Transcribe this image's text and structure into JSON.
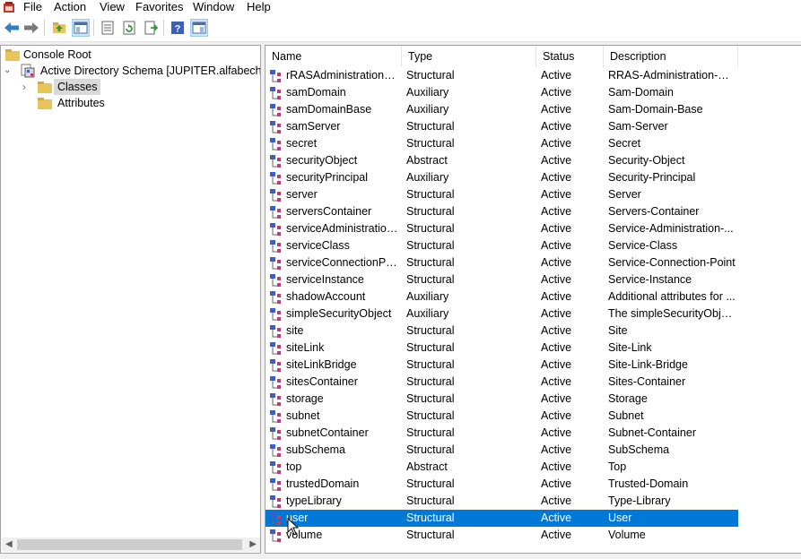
{
  "menu": [
    "File",
    "Action",
    "View",
    "Favorites",
    "Window",
    "Help"
  ],
  "tree": {
    "root": "Console Root",
    "schema": "Active Directory Schema [JUPITER.alfabech.lab]",
    "classes": "Classes",
    "attributes": "Attributes"
  },
  "columns": {
    "name": "Name",
    "type": "Type",
    "status": "Status",
    "description": "Description"
  },
  "rows": [
    {
      "name": "rRASAdministrationDi...",
      "type": "Structural",
      "status": "Active",
      "description": "RRAS-Administration-Di..."
    },
    {
      "name": "samDomain",
      "type": "Auxiliary",
      "status": "Active",
      "description": "Sam-Domain"
    },
    {
      "name": "samDomainBase",
      "type": "Auxiliary",
      "status": "Active",
      "description": "Sam-Domain-Base"
    },
    {
      "name": "samServer",
      "type": "Structural",
      "status": "Active",
      "description": "Sam-Server"
    },
    {
      "name": "secret",
      "type": "Structural",
      "status": "Active",
      "description": "Secret"
    },
    {
      "name": "securityObject",
      "type": "Abstract",
      "status": "Active",
      "description": "Security-Object"
    },
    {
      "name": "securityPrincipal",
      "type": "Auxiliary",
      "status": "Active",
      "description": "Security-Principal"
    },
    {
      "name": "server",
      "type": "Structural",
      "status": "Active",
      "description": "Server"
    },
    {
      "name": "serversContainer",
      "type": "Structural",
      "status": "Active",
      "description": "Servers-Container"
    },
    {
      "name": "serviceAdministration...",
      "type": "Structural",
      "status": "Active",
      "description": "Service-Administration-..."
    },
    {
      "name": "serviceClass",
      "type": "Structural",
      "status": "Active",
      "description": "Service-Class"
    },
    {
      "name": "serviceConnectionPoint",
      "type": "Structural",
      "status": "Active",
      "description": "Service-Connection-Point"
    },
    {
      "name": "serviceInstance",
      "type": "Structural",
      "status": "Active",
      "description": "Service-Instance"
    },
    {
      "name": "shadowAccount",
      "type": "Auxiliary",
      "status": "Active",
      "description": "Additional attributes for ..."
    },
    {
      "name": "simpleSecurityObject",
      "type": "Auxiliary",
      "status": "Active",
      "description": "The simpleSecurityObje..."
    },
    {
      "name": "site",
      "type": "Structural",
      "status": "Active",
      "description": "Site"
    },
    {
      "name": "siteLink",
      "type": "Structural",
      "status": "Active",
      "description": "Site-Link"
    },
    {
      "name": "siteLinkBridge",
      "type": "Structural",
      "status": "Active",
      "description": "Site-Link-Bridge"
    },
    {
      "name": "sitesContainer",
      "type": "Structural",
      "status": "Active",
      "description": "Sites-Container"
    },
    {
      "name": "storage",
      "type": "Structural",
      "status": "Active",
      "description": "Storage"
    },
    {
      "name": "subnet",
      "type": "Structural",
      "status": "Active",
      "description": "Subnet"
    },
    {
      "name": "subnetContainer",
      "type": "Structural",
      "status": "Active",
      "description": "Subnet-Container"
    },
    {
      "name": "subSchema",
      "type": "Structural",
      "status": "Active",
      "description": "SubSchema"
    },
    {
      "name": "top",
      "type": "Abstract",
      "status": "Active",
      "description": "Top"
    },
    {
      "name": "trustedDomain",
      "type": "Structural",
      "status": "Active",
      "description": "Trusted-Domain"
    },
    {
      "name": "typeLibrary",
      "type": "Structural",
      "status": "Active",
      "description": "Type-Library"
    },
    {
      "name": "user",
      "type": "Structural",
      "status": "Active",
      "description": "User",
      "selected": true
    },
    {
      "name": "volume",
      "type": "Structural",
      "status": "Active",
      "description": "Volume"
    }
  ],
  "colors": {
    "selection": "#0078d7",
    "iconBlue": "#3b5fc7",
    "iconMagenta": "#c0397a",
    "folder": "#e8c45a"
  }
}
